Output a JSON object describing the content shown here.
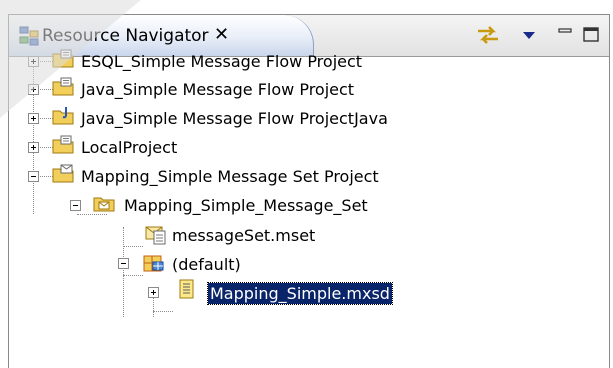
{
  "view": {
    "title": "Resource Navigator",
    "close_glyph": "✕",
    "toolbar": [
      {
        "name": "link-with-editor-icon",
        "label": ""
      },
      {
        "name": "view-menu-icon",
        "label": ""
      },
      {
        "name": "minimize-icon",
        "label": ""
      },
      {
        "name": "maximize-icon",
        "label": ""
      }
    ]
  },
  "tree": {
    "items": [
      {
        "label": "ESQL_Simple Message Flow Project",
        "icon": "project-folder-icon",
        "expanded": false
      },
      {
        "label": "Java_Simple Message Flow Project",
        "icon": "project-folder-icon",
        "expanded": false
      },
      {
        "label": "Java_Simple Message Flow ProjectJava",
        "icon": "java-project-folder-icon",
        "expanded": false
      },
      {
        "label": "LocalProject",
        "icon": "project-folder-icon",
        "expanded": false
      },
      {
        "label": "Mapping_Simple Message Set Project",
        "icon": "message-set-project-icon",
        "expanded": true
      },
      {
        "label": "Mapping_Simple_Message_Set",
        "icon": "message-set-folder-icon",
        "expanded": true
      },
      {
        "label": "messageSet.mset",
        "icon": "mset-file-icon"
      },
      {
        "label": "(default)",
        "icon": "namespace-icon",
        "expanded": true
      },
      {
        "label": "Mapping_Simple.mxsd",
        "icon": "mxsd-file-icon",
        "expanded": false,
        "selected": true
      }
    ]
  },
  "colors": {
    "selection": "#0a246a",
    "folder": "#f2cf5a",
    "tab_gradient_end": "#c9d6ec"
  }
}
